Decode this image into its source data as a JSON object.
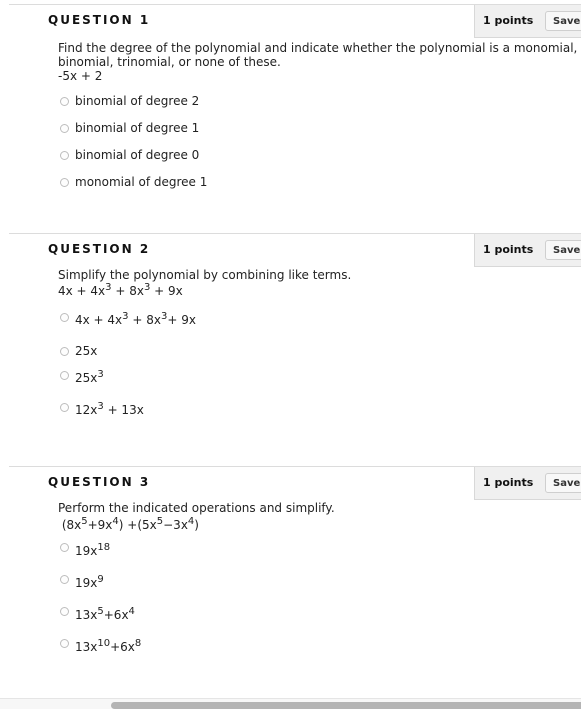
{
  "questions": [
    {
      "title": "QUESTION 1",
      "points": "1 points",
      "save_label": "Save Answer",
      "prompt_lines": [
        "Find the degree of the polynomial and indicate whether the polynomial is a monomial,",
        "binomial, trinomial, or none of these.",
        "-5x + 2"
      ],
      "choices": [
        {
          "label": "binomial of degree 2",
          "selected": false
        },
        {
          "label": "binomial of degree 1",
          "selected": false
        },
        {
          "label": "binomial of degree 0",
          "selected": false
        },
        {
          "label": "monomial of degree 1",
          "selected": false
        }
      ]
    },
    {
      "title": "QUESTION 2",
      "points": "1 points",
      "save_label": "Save Answer",
      "prompt_lines": [
        "Simplify the polynomial by combining like terms.",
        "4x + 4x^3 + 8x^3 + 9x"
      ],
      "choices": [
        {
          "label": "4x + 4x^3 + 8x^3+ 9x",
          "selected": false
        },
        {
          "label": "25x",
          "selected": false
        },
        {
          "label": "25x^3",
          "selected": false
        },
        {
          "label": "12x^3 + 13x",
          "selected": false
        }
      ]
    },
    {
      "title": "QUESTION 3",
      "points": "1 points",
      "save_label": "Save Answer",
      "prompt_lines": [
        "Perform the indicated operations and simplify.",
        " (8x^5+9x^4) +(5x^5−3x^4)"
      ],
      "choices": [
        {
          "label": "19x^18",
          "selected": false
        },
        {
          "label": "19x^9",
          "selected": false
        },
        {
          "label": "13x^5+6x^4",
          "selected": false
        },
        {
          "label": "13x^10+6x^8",
          "selected": false
        }
      ]
    }
  ],
  "scrollbar": {
    "orientation": "horizontal"
  }
}
